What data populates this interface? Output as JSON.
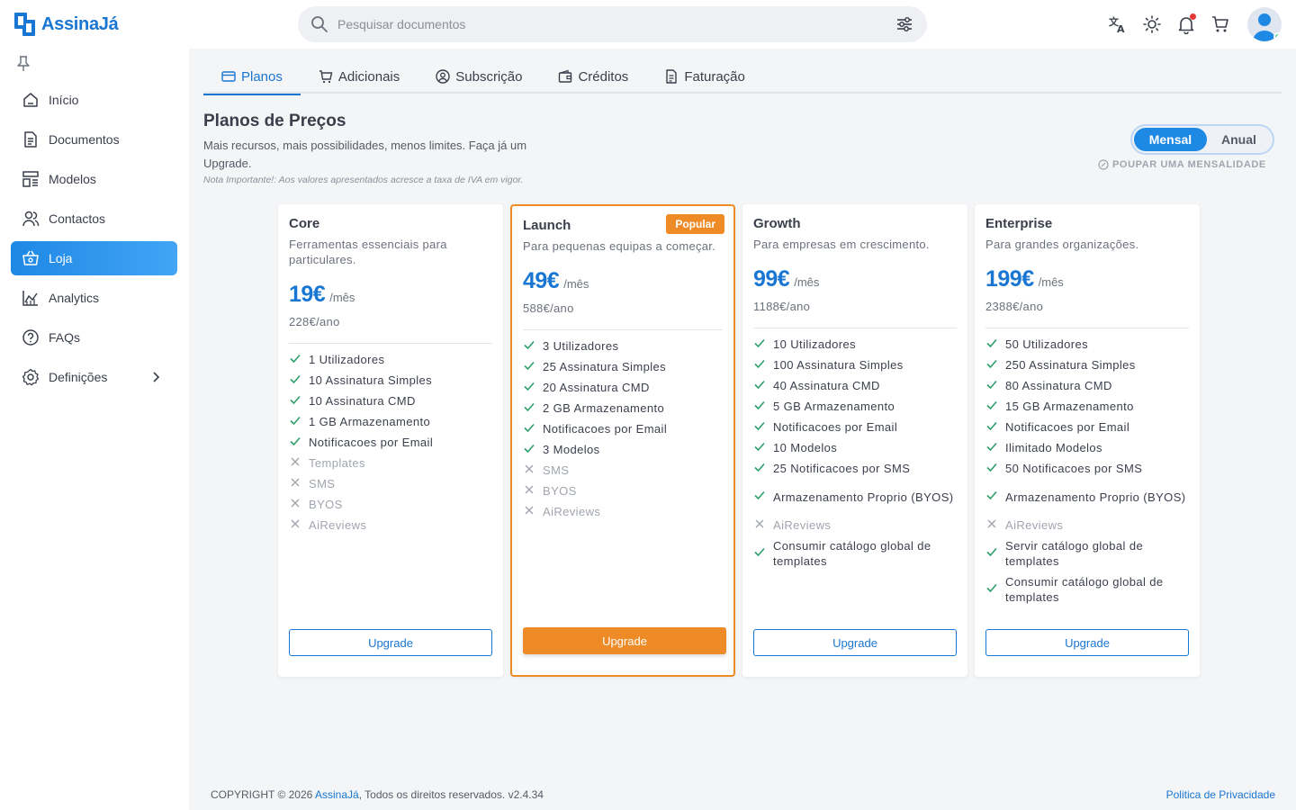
{
  "app": {
    "name": "AssinaJá"
  },
  "search": {
    "placeholder": "Pesquisar documentos"
  },
  "header_icons": [
    "translate-icon",
    "theme-sun-icon",
    "notifications-bell-icon",
    "cart-icon",
    "user-avatar"
  ],
  "sidebar": {
    "items": [
      {
        "label": "Início",
        "icon": "home-icon"
      },
      {
        "label": "Documentos",
        "icon": "document-icon"
      },
      {
        "label": "Modelos",
        "icon": "template-icon"
      },
      {
        "label": "Contactos",
        "icon": "contacts-icon"
      },
      {
        "label": "Loja",
        "icon": "shop-icon",
        "active": true
      },
      {
        "label": "Analytics",
        "icon": "analytics-icon"
      },
      {
        "label": "FAQs",
        "icon": "help-icon"
      },
      {
        "label": "Definições",
        "icon": "settings-icon"
      }
    ]
  },
  "tabs": [
    {
      "label": "Planos",
      "active": true
    },
    {
      "label": "Adicionais"
    },
    {
      "label": "Subscrição"
    },
    {
      "label": "Créditos"
    },
    {
      "label": "Faturação"
    }
  ],
  "page": {
    "title": "Planos de Preços",
    "subtitle": "Mais recursos, mais possibilidades, menos limites. Faça já um Upgrade.",
    "note": "Nota Importante!: Aos valores apresentados acresce a taxa de IVA em vigor."
  },
  "billing_toggle": {
    "monthly": "Mensal",
    "yearly": "Anual",
    "selected": "Mensal",
    "hint": "POUPAR UMA MENSALIDADE"
  },
  "plans": [
    {
      "name": "Core",
      "description": "Ferramentas essenciais para particulares.",
      "price": "19€",
      "period": "/mês",
      "yearly": "228€/ano",
      "features": [
        {
          "text": "1 Utilizadores",
          "included": true
        },
        {
          "text": "10 Assinatura Simples",
          "included": true
        },
        {
          "text": "10 Assinatura CMD",
          "included": true
        },
        {
          "text": "1 GB Armazenamento",
          "included": true
        },
        {
          "text": "Notificacoes por Email",
          "included": true
        },
        {
          "text": "Templates",
          "included": false
        },
        {
          "text": "SMS",
          "included": false
        },
        {
          "text": "BYOS",
          "included": false
        },
        {
          "text": "AiReviews",
          "included": false
        }
      ],
      "button": "Upgrade"
    },
    {
      "name": "Launch",
      "badge": "Popular",
      "description": "Para pequenas equipas a começar.",
      "price": "49€",
      "period": "/mês",
      "yearly": "588€/ano",
      "features": [
        {
          "text": "3 Utilizadores",
          "included": true
        },
        {
          "text": "25 Assinatura Simples",
          "included": true
        },
        {
          "text": "20 Assinatura CMD",
          "included": true
        },
        {
          "text": "2 GB Armazenamento",
          "included": true
        },
        {
          "text": "Notificacoes por Email",
          "included": true
        },
        {
          "text": "3 Modelos",
          "included": true
        },
        {
          "text": "SMS",
          "included": false
        },
        {
          "text": "BYOS",
          "included": false
        },
        {
          "text": "AiReviews",
          "included": false
        }
      ],
      "button": "Upgrade"
    },
    {
      "name": "Growth",
      "description": "Para empresas em crescimento.",
      "price": "99€",
      "period": "/mês",
      "yearly": "1188€/ano",
      "features": [
        {
          "text": "10 Utilizadores",
          "included": true
        },
        {
          "text": "100 Assinatura Simples",
          "included": true
        },
        {
          "text": "40 Assinatura CMD",
          "included": true
        },
        {
          "text": "5 GB Armazenamento",
          "included": true
        },
        {
          "text": "Notificacoes por Email",
          "included": true
        },
        {
          "text": "10 Modelos",
          "included": true
        },
        {
          "text": "25 Notificacoes por SMS",
          "included": true
        },
        {
          "text": "Armazenamento Proprio (BYOS)",
          "included": true
        },
        {
          "text": "AiReviews",
          "included": false
        },
        {
          "text": "Consumir catálogo global de templates",
          "included": true
        }
      ],
      "button": "Upgrade"
    },
    {
      "name": "Enterprise",
      "description": "Para grandes organizações.",
      "price": "199€",
      "period": "/mês",
      "yearly": "2388€/ano",
      "features": [
        {
          "text": "50 Utilizadores",
          "included": true
        },
        {
          "text": "250 Assinatura Simples",
          "included": true
        },
        {
          "text": "80 Assinatura CMD",
          "included": true
        },
        {
          "text": "15 GB Armazenamento",
          "included": true
        },
        {
          "text": "Notificacoes por Email",
          "included": true
        },
        {
          "text": "Ilimitado Modelos",
          "included": true
        },
        {
          "text": "50 Notificacoes por SMS",
          "included": true
        },
        {
          "text": "Armazenamento Proprio (BYOS)",
          "included": true
        },
        {
          "text": "AiReviews",
          "included": false
        },
        {
          "text": "Servir catálogo global de templates",
          "included": true
        },
        {
          "text": "Consumir catálogo global de templates",
          "included": true
        }
      ],
      "button": "Upgrade"
    }
  ],
  "footer": {
    "copyright_prefix": "COPYRIGHT © 2026",
    "brand": "AssinaJá",
    "copyright_suffix": ", Todos os direitos reservados. v2.4.34",
    "privacy": "Politica de Privacidade"
  },
  "colors": {
    "accent": "#1976d2",
    "popular": "#ee8b27",
    "check": "#2e9e6b"
  }
}
